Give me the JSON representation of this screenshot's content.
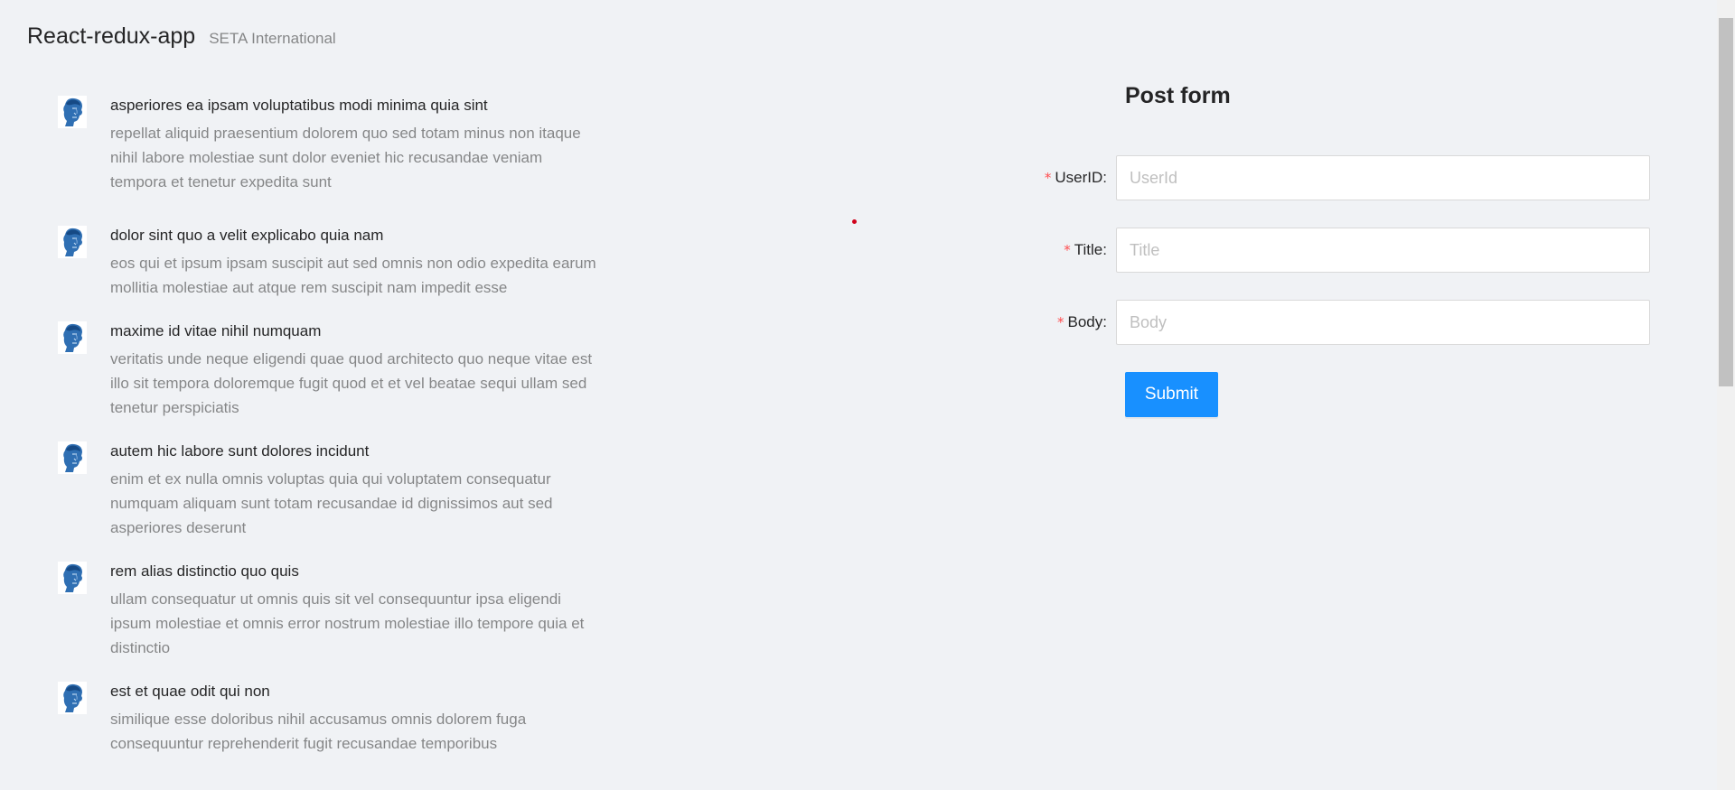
{
  "header": {
    "title": "React-redux-app",
    "subtitle": "SETA International"
  },
  "posts": [
    {
      "title": "asperiores ea ipsam voluptatibus modi minima quia sint",
      "body": "repellat aliquid praesentium dolorem quo sed totam minus non itaque nihil labore molestiae sunt dolor eveniet hic recusandae veniam tempora et tenetur expedita sunt",
      "avatar": "avatar-icon"
    },
    {
      "title": "dolor sint quo a velit explicabo quia nam",
      "body": "eos qui et ipsum ipsam suscipit aut sed omnis non odio expedita earum mollitia molestiae aut atque rem suscipit nam impedit esse",
      "avatar": "avatar-icon"
    },
    {
      "title": "maxime id vitae nihil numquam",
      "body": "veritatis unde neque eligendi quae quod architecto quo neque vitae est illo sit tempora doloremque fugit quod et et vel beatae sequi ullam sed tenetur perspiciatis",
      "avatar": "avatar-icon"
    },
    {
      "title": "autem hic labore sunt dolores incidunt",
      "body": "enim et ex nulla omnis voluptas quia qui voluptatem consequatur numquam aliquam sunt totam recusandae id dignissimos aut sed asperiores deserunt",
      "avatar": "avatar-icon"
    },
    {
      "title": "rem alias distinctio quo quis",
      "body": "ullam consequatur ut omnis quis sit vel consequuntur ipsa eligendi ipsum molestiae et omnis error nostrum molestiae illo tempore quia et distinctio",
      "avatar": "avatar-icon"
    },
    {
      "title": "est et quae odit qui non",
      "body": "similique esse doloribus nihil accusamus omnis dolorem fuga consequuntur reprehenderit fugit recusandae temporibus",
      "avatar": "avatar-icon"
    }
  ],
  "form": {
    "heading": "Post form",
    "required_mark": "*",
    "fields": [
      {
        "label": "UserID",
        "colon": ":",
        "placeholder": "UserId",
        "value": ""
      },
      {
        "label": "Title",
        "colon": ":",
        "placeholder": "Title",
        "value": ""
      },
      {
        "label": "Body",
        "colon": ":",
        "placeholder": "Body",
        "value": ""
      }
    ],
    "submit_label": "Submit"
  },
  "colors": {
    "background": "#f0f2f5",
    "primary": "#1890ff",
    "required": "#ff4d4f",
    "dot": "#d0021b"
  }
}
